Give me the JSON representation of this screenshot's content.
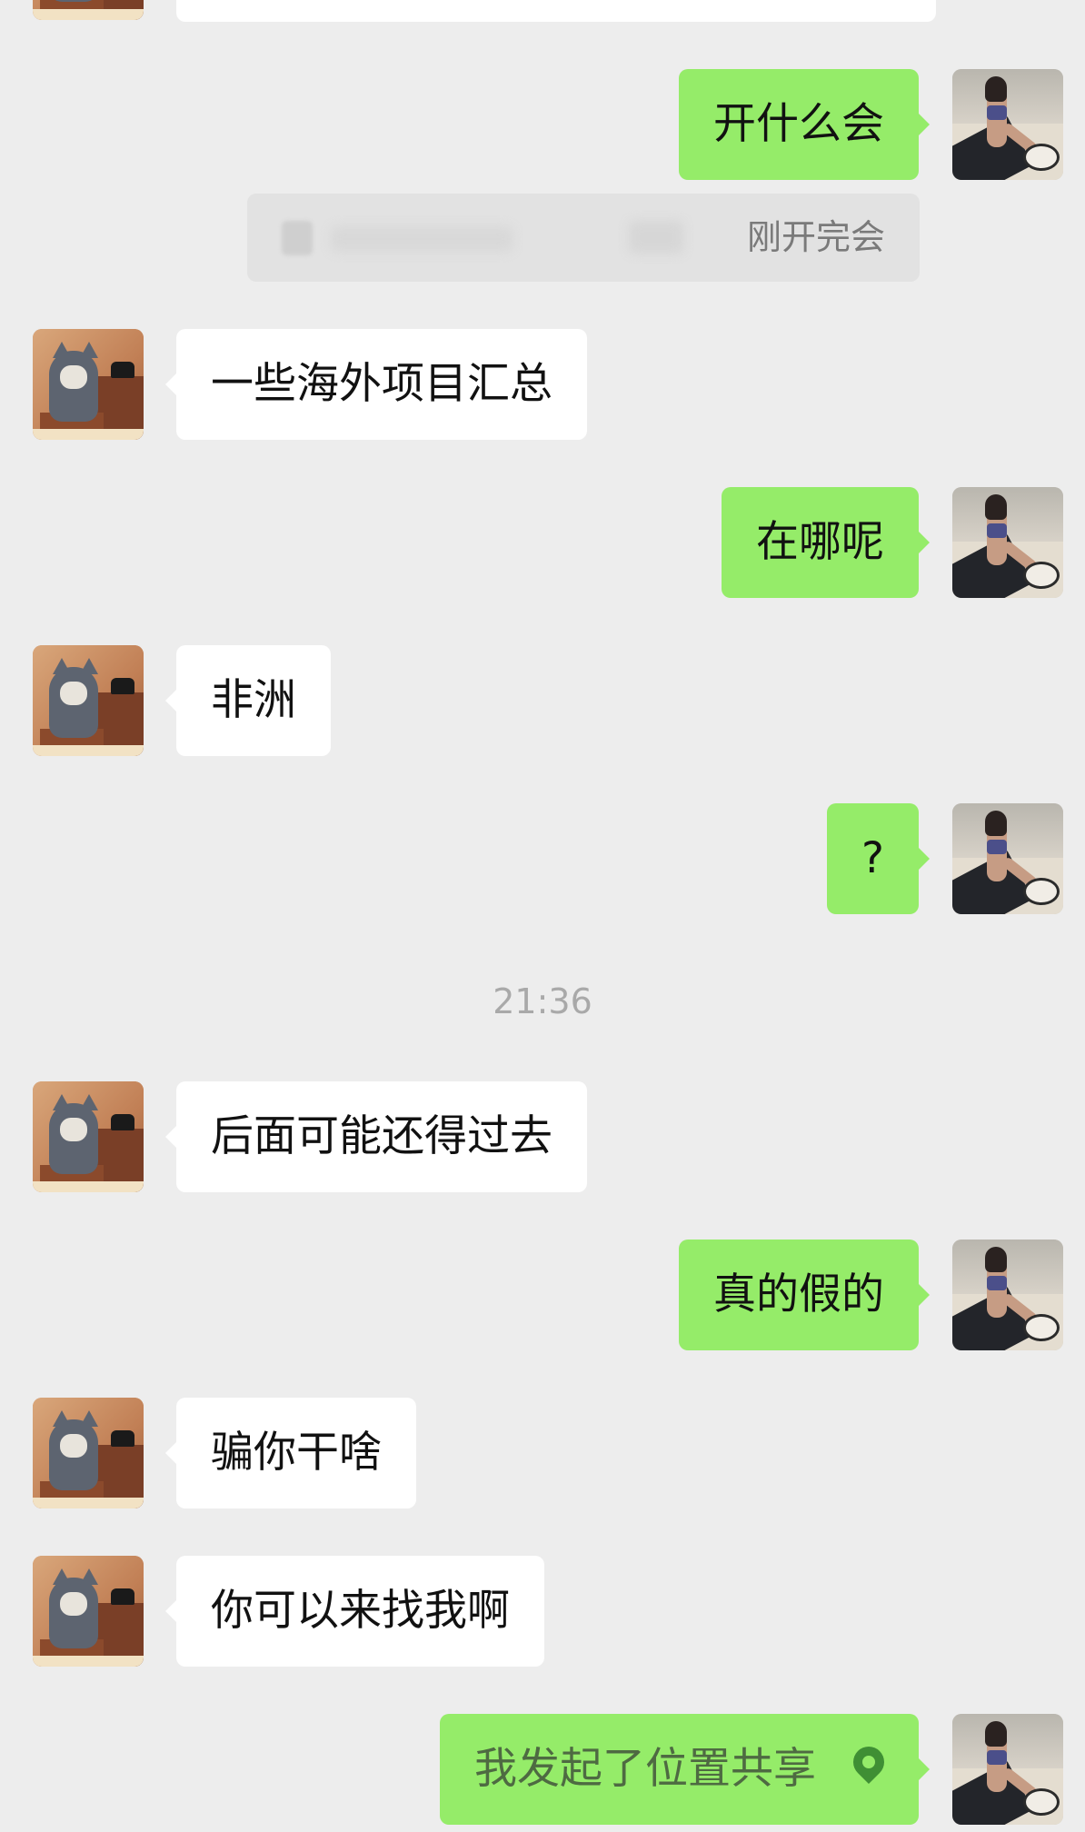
{
  "chat": {
    "messages": [
      {
        "side": "right",
        "text": "开什么会"
      },
      {
        "side": "quote",
        "text": "刚开完会"
      },
      {
        "side": "left",
        "text": "一些海外项目汇总"
      },
      {
        "side": "right",
        "text": "在哪呢"
      },
      {
        "side": "left",
        "text": "非洲"
      },
      {
        "side": "right",
        "text": "?"
      },
      {
        "side": "time",
        "text": "21:36"
      },
      {
        "side": "left",
        "text": "后面可能还得过去"
      },
      {
        "side": "right",
        "text": "真的假的"
      },
      {
        "side": "left",
        "text": "骗你干啥"
      },
      {
        "side": "left",
        "text": "你可以来找我啊"
      },
      {
        "side": "right",
        "text": "我发起了位置共享",
        "icon": "location-pin-icon"
      }
    ]
  },
  "colors": {
    "background": "#ededed",
    "incoming_bubble": "#ffffff",
    "outgoing_bubble": "#95ec69",
    "timestamp": "#a9a9a9"
  }
}
